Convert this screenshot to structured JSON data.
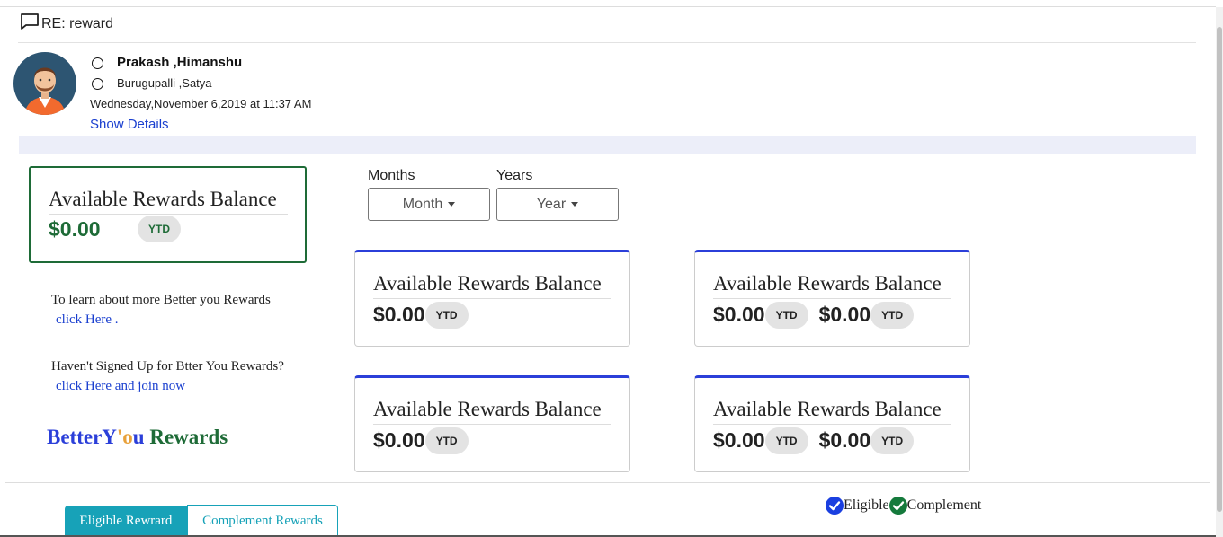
{
  "email": {
    "subject": "RE: reward",
    "from": "Prakash ,Himanshu",
    "to": "Burugupalli ,Satya",
    "date": "Wednesday,November 6,2019 at 11:37 AM",
    "show_details": "Show Details"
  },
  "main_balance": {
    "title": "Available Rewards Balance",
    "amount": "$0.00",
    "badge": "YTD"
  },
  "info": {
    "learn_text": "To learn about more Better you Rewards",
    "learn_link": "click Here .",
    "signup_text": "Haven't Signed Up for Btter You Rewards?",
    "signup_link": "click Here and join now"
  },
  "brand": {
    "part1": "BetterY",
    "part2": "'o",
    "part3": "u",
    "part4": " Rewards"
  },
  "filters": {
    "months_label": "Months",
    "years_label": "Years",
    "month_value": "Month",
    "year_value": "Year"
  },
  "cards": [
    {
      "title": "Available Rewards Balance",
      "amount1": "$0.00",
      "badge1": "YTD"
    },
    {
      "title": "Available Rewards Balance",
      "amount1": "$0.00",
      "badge1": "YTD",
      "amount2": "$0.00",
      "badge2": "YTD"
    },
    {
      "title": "Available Rewards Balance",
      "amount1": "$0.00",
      "badge1": "YTD"
    },
    {
      "title": "Available Rewards Balance",
      "amount1": "$0.00",
      "badge1": "YTD",
      "amount2": "$0.00",
      "badge2": "YTD"
    }
  ],
  "tabs": {
    "eligible": "Eligible Rewrard",
    "complement": "Complement Rewards"
  },
  "legend": {
    "eligible": "Eligible",
    "complement": "Complement",
    "eligible_color": "#1a3fe0",
    "complement_color": "#157a3c"
  },
  "icons": {
    "subject": "chat-bubble-icon",
    "legend_eligible": "check-circle-icon",
    "legend_complement": "check-circle-icon"
  }
}
